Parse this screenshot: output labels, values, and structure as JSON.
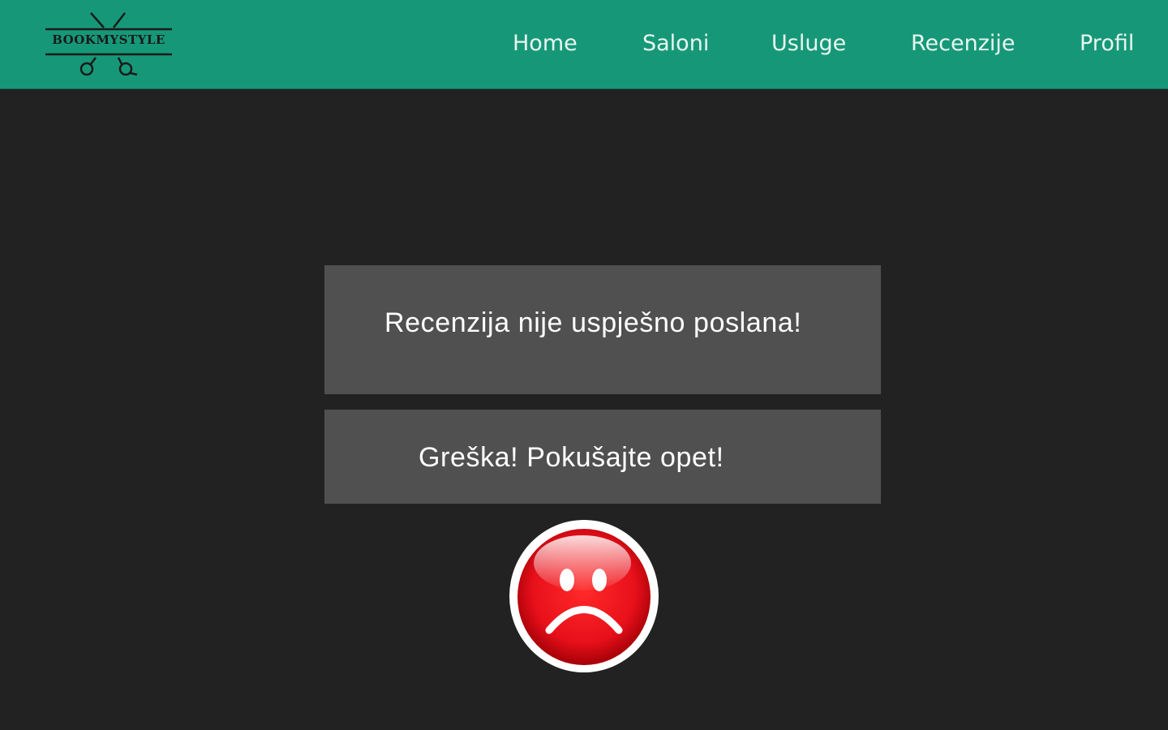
{
  "brand": {
    "logo_text": "BOOKMYSTYLE",
    "color": "#169878"
  },
  "nav": {
    "items": [
      {
        "label": "Home"
      },
      {
        "label": "Saloni"
      },
      {
        "label": "Usluge"
      },
      {
        "label": "Recenzije"
      },
      {
        "label": "Profil"
      }
    ]
  },
  "main": {
    "message_title": "Recenzija nije uspješno poslana!",
    "message_subtitle": "Greška! Pokušajte opet!",
    "status_icon": "sad-face-icon",
    "status_color": "#e8101a"
  },
  "colors": {
    "background": "#222222",
    "panel": "#505050"
  }
}
